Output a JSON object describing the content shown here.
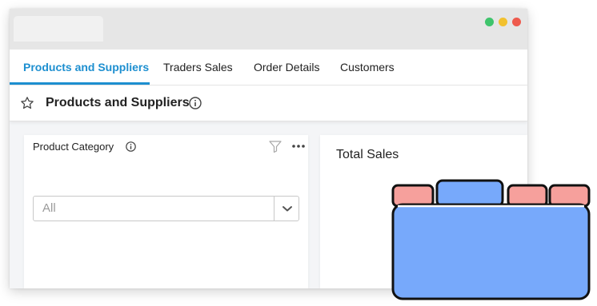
{
  "window": {
    "controls": [
      {
        "name": "maximize",
        "color": "#3fc46c"
      },
      {
        "name": "minimize",
        "color": "#f2c12f"
      },
      {
        "name": "close",
        "color": "#ee5a4d"
      }
    ]
  },
  "tabs": [
    {
      "label": "Products and Suppliers",
      "active": true
    },
    {
      "label": "Traders Sales",
      "active": false
    },
    {
      "label": "Order Details",
      "active": false
    },
    {
      "label": "Customers",
      "active": false
    }
  ],
  "page": {
    "title": "Products and Suppliers",
    "favorite_icon": "star-icon",
    "info_icon": "info-icon"
  },
  "product_card": {
    "title": "Product Category",
    "info_icon": "info-icon",
    "filter_icon": "filter-icon",
    "menu_icon": "more-icon",
    "select": {
      "value": "All",
      "icon": "chevron-down-icon"
    }
  },
  "sales_card": {
    "title": "Total Sales"
  },
  "colors": {
    "accent": "#1d8fd0",
    "graphic_blue": "#77a9fb",
    "graphic_red": "#f6a09c",
    "graphic_outline": "#111111"
  }
}
